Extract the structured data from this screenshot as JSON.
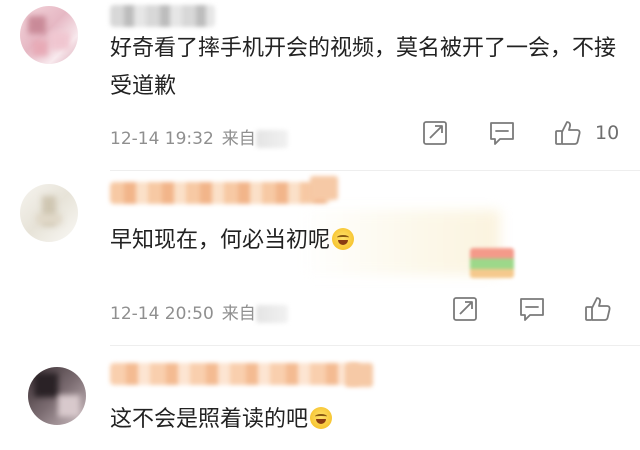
{
  "comments": [
    {
      "text": "好奇看了摔手机开会的视频，莫名被开了一会，不接受道歉",
      "date": "12-14 19:32",
      "location_prefix": "来自",
      "likes": "10"
    },
    {
      "text": "早知现在，何必当初呢",
      "date": "12-14 20:50",
      "location_prefix": "来自",
      "likes": ""
    },
    {
      "text": "这不会是照着读的吧",
      "date": "",
      "location_prefix": "",
      "likes": ""
    }
  ],
  "icons": {
    "share": "share-icon",
    "comment": "comment-icon",
    "like": "like-icon",
    "emoji": "laugh-cry-emoji"
  },
  "colors": {
    "text": "#222222",
    "meta": "#8f8f8f",
    "icon": "#7a7a7a",
    "divider": "#eeeeee"
  }
}
